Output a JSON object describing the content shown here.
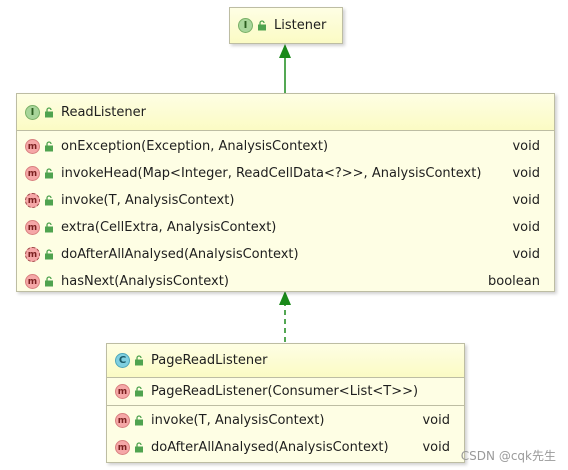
{
  "listener": {
    "badge": "I",
    "name": "Listener"
  },
  "read_listener": {
    "badge": "I",
    "name": "ReadListener",
    "methods": [
      {
        "badge": "m",
        "signature": "onException(Exception, AnalysisContext)",
        "return": "void",
        "abstract": false
      },
      {
        "badge": "m",
        "signature": "invokeHead(Map<Integer, ReadCellData<?>>, AnalysisContext)",
        "return": "void",
        "abstract": false
      },
      {
        "badge": "m",
        "signature": "invoke(T, AnalysisContext)",
        "return": "void",
        "abstract": true
      },
      {
        "badge": "m",
        "signature": "extra(CellExtra, AnalysisContext)",
        "return": "void",
        "abstract": false
      },
      {
        "badge": "m",
        "signature": "doAfterAllAnalysed(AnalysisContext)",
        "return": "void",
        "abstract": true
      },
      {
        "badge": "m",
        "signature": "hasNext(AnalysisContext)",
        "return": "boolean",
        "abstract": false
      }
    ]
  },
  "page_read_listener": {
    "badge": "C",
    "name": "PageReadListener",
    "constructors": [
      {
        "badge": "m",
        "signature": "PageReadListener(Consumer<List<T>>)",
        "return": ""
      }
    ],
    "methods": [
      {
        "badge": "m",
        "signature": "invoke(T, AnalysisContext)",
        "return": "void"
      },
      {
        "badge": "m",
        "signature": "doAfterAllAnalysed(AnalysisContext)",
        "return": "void"
      }
    ]
  },
  "watermark": "CSDN @cqk先生",
  "colors": {
    "box_fill": "#fefee4",
    "box_border": "#bdbda3",
    "arrow": "#1a8a1a",
    "interface_badge": "#a8d59a",
    "class_badge": "#7fcfe0",
    "method_badge": "#f5a7a7",
    "lock": "#4fa34f"
  }
}
